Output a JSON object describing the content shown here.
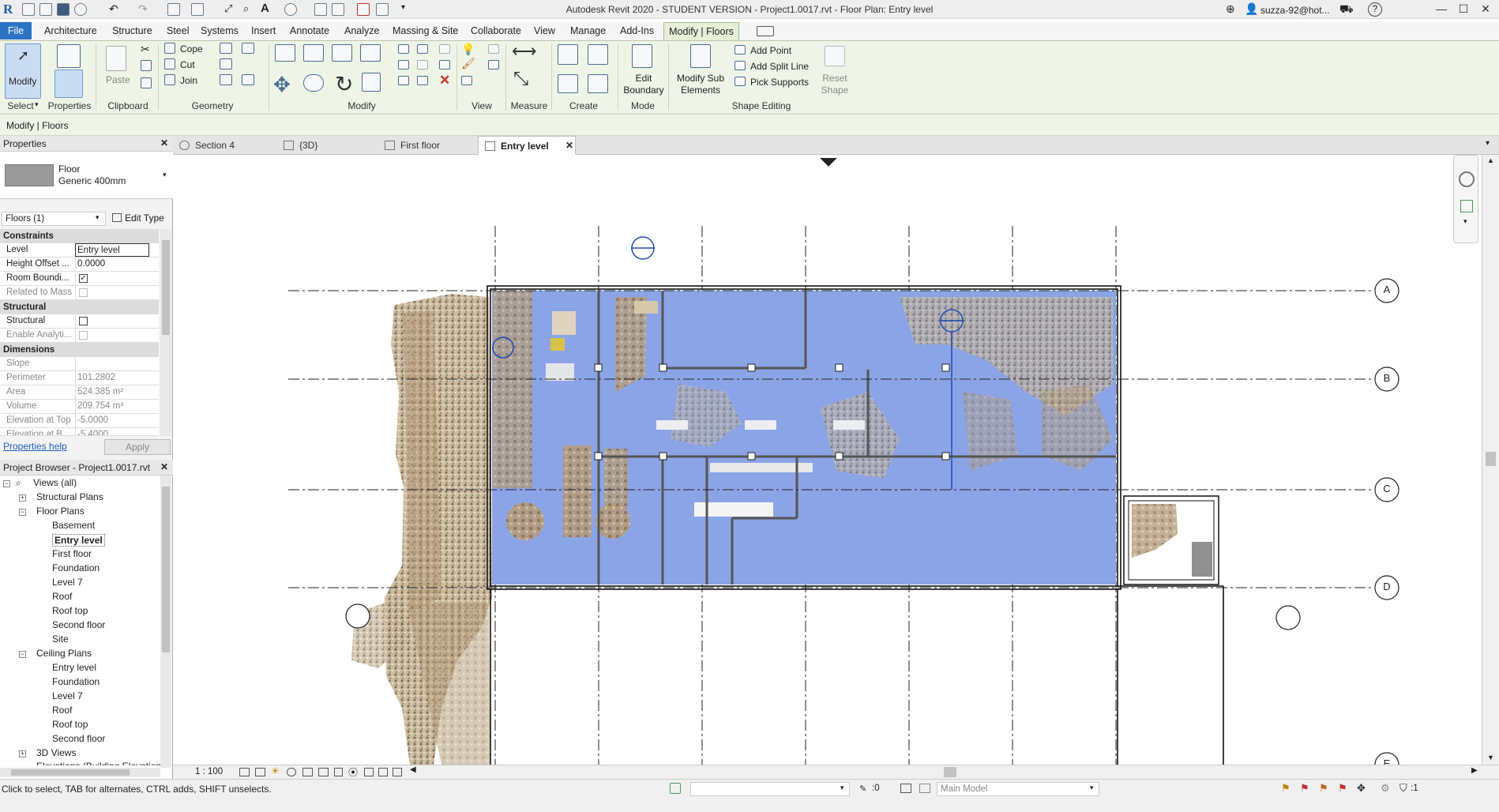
{
  "window": {
    "title": "Autodesk Revit 2020 - STUDENT VERSION - Project1.0017.rvt - Floor Plan: Entry level",
    "user": "suzza-92@hot...",
    "help": "?"
  },
  "menu": {
    "file": "File",
    "items": [
      "Architecture",
      "Structure",
      "Steel",
      "Systems",
      "Insert",
      "Annotate",
      "Analyze",
      "Massing & Site",
      "Collaborate",
      "View",
      "Manage",
      "Add-Ins"
    ],
    "active": "Modify | Floors"
  },
  "ribbon": {
    "modify": "Modify",
    "select": "Select",
    "properties": "Properties",
    "clipboard": "Clipboard",
    "paste": "Paste",
    "cope": "Cope",
    "cut": "Cut",
    "join": "Join",
    "geometry": "Geometry",
    "modify_panel": "Modify",
    "view": "View",
    "measure": "Measure",
    "create": "Create",
    "edit_boundary": "Edit Boundary",
    "mode": "Mode",
    "modify_sub": "Modify Sub Elements",
    "add_point": "Add Point",
    "add_split_line": "Add Split Line",
    "pick_supports": "Pick Supports",
    "reset_shape": "Reset Shape",
    "shape_editing": "Shape Editing"
  },
  "context_label": "Modify | Floors",
  "view_tabs": [
    "Section 4",
    "{3D}",
    "First floor",
    "Entry level"
  ],
  "properties": {
    "header": "Properties",
    "type_name": "Floor",
    "type_sub": "Generic 400mm",
    "selector": "Floors (1)",
    "edit_type": "Edit Type",
    "sections": {
      "constraints": "Constraints",
      "structural": "Structural",
      "dimensions": "Dimensions"
    },
    "rows": {
      "level": [
        "Level",
        "Entry level"
      ],
      "height_offset": [
        "Height Offset ...",
        "0.0000"
      ],
      "room_bounding": [
        "Room Boundi...",
        ""
      ],
      "related_mass": [
        "Related to Mass",
        ""
      ],
      "structural": [
        "Structural",
        ""
      ],
      "enable_analytic": [
        "Enable Analyti...",
        ""
      ],
      "slope": [
        "Slope",
        ""
      ],
      "perimeter": [
        "Perimeter",
        "101.2802"
      ],
      "area": [
        "Area",
        "524.385 m²"
      ],
      "volume": [
        "Volume",
        "209.754 m³"
      ],
      "elev_top": [
        "Elevation at Top",
        "-5.0000"
      ],
      "elev_bottom": [
        "Elevation at B...",
        "-5.4000"
      ]
    },
    "help": "Properties help",
    "apply": "Apply"
  },
  "browser": {
    "header": "Project Browser - Project1.0017.rvt",
    "views_all": "Views (all)",
    "structural_plans": "Structural Plans",
    "floor_plans": "Floor Plans",
    "floor_items": [
      "Basement",
      "Entry level",
      "First floor",
      "Foundation",
      "Level 7",
      "Roof",
      "Roof top",
      "Second floor",
      "Site"
    ],
    "ceiling_plans": "Ceiling Plans",
    "ceiling_items": [
      "Entry level",
      "Foundation",
      "Level 7",
      "Roof",
      "Roof top",
      "Second floor"
    ],
    "views_3d": "3D Views",
    "elevations": "Elevations (Building Elevation)"
  },
  "grid_labels": [
    "A",
    "B",
    "C",
    "D",
    "E"
  ],
  "scale": "1 : 100",
  "status": {
    "text": "Click to select, TAB for alternates, CTRL adds, SHIFT unselects.",
    "workset_val": ":0",
    "model": "Main Model",
    "filter_count": ":1"
  },
  "colors": {
    "floor_fill": "#8ba4e6",
    "ribbon_bg": "#eef4e6",
    "file_tab": "#2b73c5"
  }
}
